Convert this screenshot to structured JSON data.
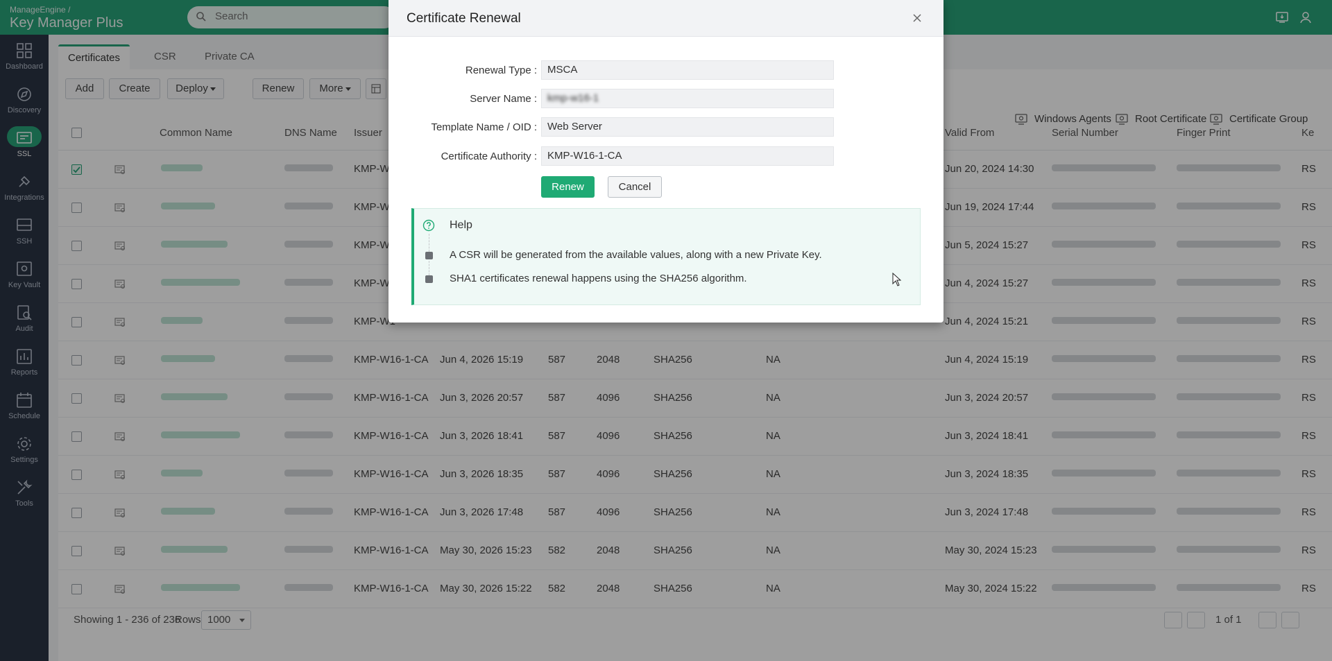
{
  "header": {
    "brand_top": "ManageEngine /",
    "brand_main": "Key Manager",
    "brand_suffix": "Plus",
    "search_placeholder": "Search"
  },
  "sidebar": {
    "items": [
      {
        "label": "Dashboard",
        "icon": "dashboard-icon"
      },
      {
        "label": "Discovery",
        "icon": "discovery-icon"
      },
      {
        "label": "SSL",
        "icon": "ssl-icon",
        "active": true
      },
      {
        "label": "Integrations",
        "icon": "integrations-icon"
      },
      {
        "label": "SSH",
        "icon": "ssh-icon"
      },
      {
        "label": "Key Vault",
        "icon": "key-vault-icon"
      },
      {
        "label": "Audit",
        "icon": "audit-icon"
      },
      {
        "label": "Reports",
        "icon": "reports-icon"
      },
      {
        "label": "Schedule",
        "icon": "schedule-icon"
      },
      {
        "label": "Settings",
        "icon": "settings-icon"
      },
      {
        "label": "Tools",
        "icon": "tools-icon"
      }
    ]
  },
  "tabs": [
    "Certificates",
    "CSR",
    "Private CA"
  ],
  "toolbar": {
    "add": "Add",
    "create": "Create",
    "deploy": "Deploy",
    "renew": "Renew",
    "more": "More"
  },
  "right_links": {
    "windows_agents": "Windows Agents",
    "root_certificate": "Root Certificate",
    "certificate_group": "Certificate Group"
  },
  "table": {
    "columns": {
      "common_name": "Common Name",
      "dns_name": "DNS Name",
      "issuer": "Issuer",
      "valid_from": "Valid From",
      "serial_number": "Serial Number",
      "finger_print": "Finger Print",
      "key": "Ke"
    },
    "rows": [
      {
        "issuer": "KMP-W1",
        "expiry": "",
        "days": "",
        "key_size": "",
        "sig": "",
        "status": "",
        "valid_from": "Jun 20, 2024 14:30",
        "key": "RS",
        "checked": true
      },
      {
        "issuer": "KMP-W1",
        "expiry": "",
        "days": "",
        "key_size": "",
        "sig": "",
        "status": "",
        "valid_from": "Jun 19, 2024 17:44",
        "key": "RS",
        "checked": false
      },
      {
        "issuer": "KMP-W1",
        "expiry": "",
        "days": "",
        "key_size": "",
        "sig": "",
        "status": "",
        "valid_from": "Jun 5, 2024 15:27",
        "key": "RS",
        "checked": false
      },
      {
        "issuer": "KMP-W1",
        "expiry": "",
        "days": "",
        "key_size": "",
        "sig": "",
        "status": "",
        "valid_from": "Jun 4, 2024 15:27",
        "key": "RS",
        "checked": false
      },
      {
        "issuer": "KMP-W1",
        "expiry": "",
        "days": "",
        "key_size": "",
        "sig": "",
        "status": "",
        "valid_from": "Jun 4, 2024 15:21",
        "key": "RS",
        "checked": false
      },
      {
        "issuer": "KMP-W16-1-CA",
        "expiry": "Jun 4, 2026 15:19",
        "days": "587",
        "key_size": "2048",
        "sig": "SHA256",
        "status": "NA",
        "valid_from": "Jun 4, 2024 15:19",
        "key": "RS",
        "checked": false
      },
      {
        "issuer": "KMP-W16-1-CA",
        "expiry": "Jun 3, 2026 20:57",
        "days": "587",
        "key_size": "4096",
        "sig": "SHA256",
        "status": "NA",
        "valid_from": "Jun 3, 2024 20:57",
        "key": "RS",
        "checked": false
      },
      {
        "issuer": "KMP-W16-1-CA",
        "expiry": "Jun 3, 2026 18:41",
        "days": "587",
        "key_size": "4096",
        "sig": "SHA256",
        "status": "NA",
        "valid_from": "Jun 3, 2024 18:41",
        "key": "RS",
        "checked": false
      },
      {
        "issuer": "KMP-W16-1-CA",
        "expiry": "Jun 3, 2026 18:35",
        "days": "587",
        "key_size": "4096",
        "sig": "SHA256",
        "status": "NA",
        "valid_from": "Jun 3, 2024 18:35",
        "key": "RS",
        "checked": false
      },
      {
        "issuer": "KMP-W16-1-CA",
        "expiry": "Jun 3, 2026 17:48",
        "days": "587",
        "key_size": "4096",
        "sig": "SHA256",
        "status": "NA",
        "valid_from": "Jun 3, 2024 17:48",
        "key": "RS",
        "checked": false
      },
      {
        "issuer": "KMP-W16-1-CA",
        "expiry": "May 30, 2026 15:23",
        "days": "582",
        "key_size": "2048",
        "sig": "SHA256",
        "status": "NA",
        "valid_from": "May 30, 2024 15:23",
        "key": "RS",
        "checked": false
      },
      {
        "issuer": "KMP-W16-1-CA",
        "expiry": "May 30, 2026 15:22",
        "days": "582",
        "key_size": "2048",
        "sig": "SHA256",
        "status": "NA",
        "valid_from": "May 30, 2024 15:22",
        "key": "RS",
        "checked": false
      }
    ]
  },
  "footer": {
    "showing": "Showing 1 - 236 of 236",
    "rows_label": "Rows",
    "rows_value": "1000",
    "page": "1 of 1"
  },
  "dialog": {
    "title": "Certificate Renewal",
    "fields": [
      {
        "label": "Renewal Type :",
        "value": "MSCA"
      },
      {
        "label": "Server Name :",
        "value": "kmp-w16-1"
      },
      {
        "label": "Template Name / OID :",
        "value": "Web Server"
      },
      {
        "label": "Certificate Authority :",
        "value": "KMP-W16-1-CA"
      }
    ],
    "renew_label": "Renew",
    "cancel_label": "Cancel",
    "help": {
      "title": "Help",
      "items": [
        "A CSR will be generated from the available values, along with a new Private Key.",
        "SHA1 certificates renewal happens using the SHA256 algorithm."
      ]
    }
  },
  "colors": {
    "brand_green": "#29a37a",
    "button_green": "#1faa74",
    "sidebar_bg": "#2b3445"
  }
}
